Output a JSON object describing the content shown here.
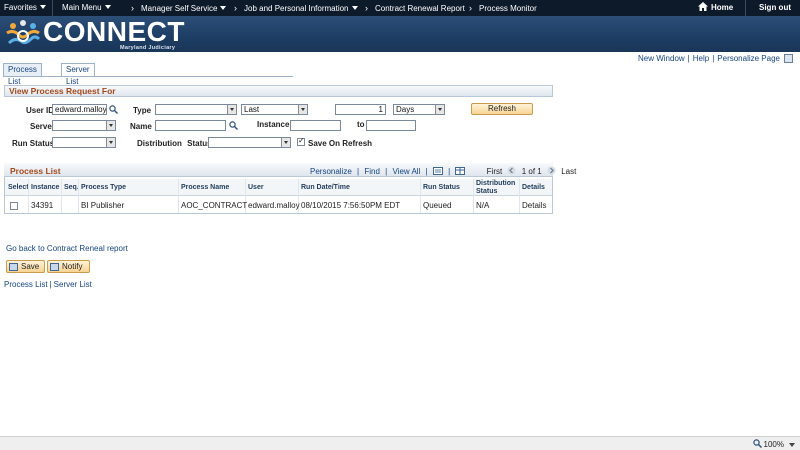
{
  "topbar": {
    "favorites": "Favorites",
    "main_menu": "Main Menu",
    "crumbs": [
      "Manager Self Service",
      "Job and Personal Information",
      "Contract Renewal Report",
      "Process Monitor"
    ],
    "home": "Home",
    "signout": "Sign out"
  },
  "brand": {
    "name": "CONNECT",
    "subtitle": "Maryland Judiciary"
  },
  "header_links": {
    "new_window": "New Window",
    "help": "Help",
    "personalize": "Personalize Page"
  },
  "tabs": [
    {
      "label": "Process List"
    },
    {
      "label": "Server List"
    }
  ],
  "form": {
    "title": "View Process Request For",
    "user_id_label": "User ID",
    "user_id_value": "edward.malloy",
    "type_label": "Type",
    "type_value": "",
    "last_value": "Last",
    "number_value": "1",
    "days_value": "Days",
    "refresh": "Refresh",
    "server_label": "Server",
    "server_value": "",
    "name_label": "Name",
    "name_value": "",
    "instance_label": "Instance",
    "instance_from": "",
    "to_label": "to",
    "instance_to": "",
    "run_status_label": "Run Status",
    "run_status_value": "",
    "dist_status_label": "Distribution",
    "dist_status_label2": "Status",
    "dist_status_value": "",
    "save_on_refresh": "Save On Refresh",
    "save_on_refresh_checked": true
  },
  "process_list": {
    "title": "Process List",
    "personalize": "Personalize",
    "find": "Find",
    "view_all": "View All",
    "first": "First",
    "range": "1 of 1",
    "last": "Last",
    "columns": [
      "Select",
      "Instance",
      "Seq.",
      "Process Type",
      "Process Name",
      "User",
      "Run Date/Time",
      "Run Status",
      "Distribution",
      "Status",
      "Details"
    ],
    "rows": [
      {
        "instance": "34391",
        "seq": "",
        "type": "BI Publisher",
        "name": "AOC_CONTRACT",
        "user": "edward.malloy",
        "datetime": "08/10/2015  7:56:50PM EDT",
        "run_status": "Queued",
        "dist_status": "N/A",
        "details": "Details"
      }
    ]
  },
  "back_link": "Go back to Contract Reneal report",
  "buttons": {
    "save": "Save",
    "notify": "Notify"
  },
  "bottom_links": {
    "process_list": "Process List",
    "server_list": "Server List"
  },
  "statusbar": {
    "zoom": "100%"
  }
}
